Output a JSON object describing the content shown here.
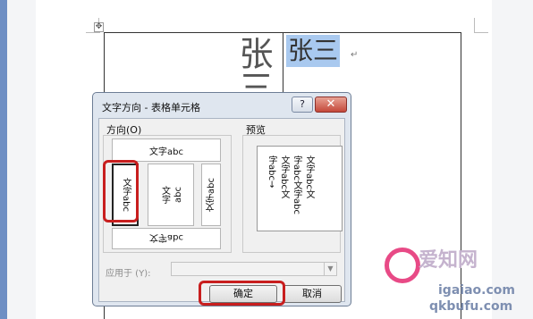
{
  "document": {
    "vertical_text": "张三",
    "selected_text": "张三",
    "para_mark": "↵",
    "move_handle": "✥"
  },
  "dialog": {
    "title": "文字方向 - 表格单元格",
    "help_label": "?",
    "close_label": "✕",
    "direction_group": "方向(O)",
    "preview_group": "预览",
    "options": {
      "horizontal": "文字abc",
      "vertical_rotated_right": "文字abc",
      "vertical_stacked_1": "文字",
      "vertical_stacked_2": "abc",
      "vertical_rotated_left": "文字abc",
      "horizontal_flipped": "文字abc"
    },
    "preview_text": "文字abc文\n字abc文字abc\n文字abc文\n字abc→",
    "apply_label": "应用于 (Y):",
    "apply_value": "",
    "ok_label": "确定",
    "cancel_label": "取消"
  },
  "watermark": {
    "text": "爱知网",
    "url1": "igaiao.com",
    "url2": "qkbufu.com"
  }
}
